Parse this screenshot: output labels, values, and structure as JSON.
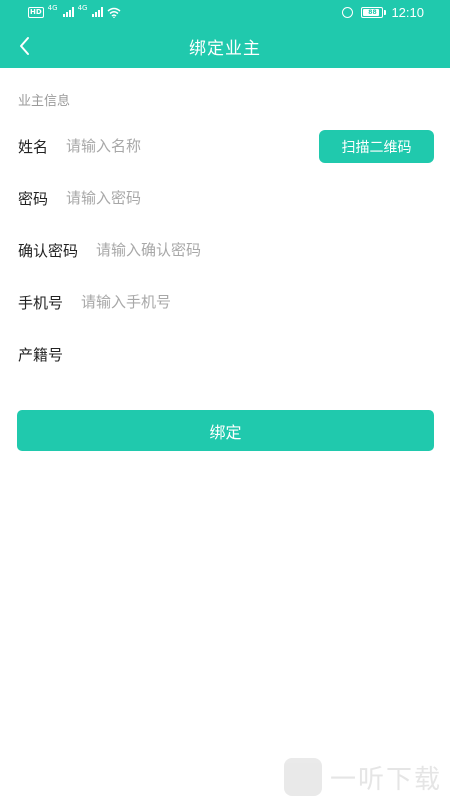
{
  "status_bar": {
    "hd": "HD",
    "sig_tag_1": "4G",
    "sig_tag_2": "4G",
    "battery": "88",
    "time": "12:10"
  },
  "header": {
    "title": "绑定业主"
  },
  "form": {
    "section_title": "业主信息",
    "fields": [
      {
        "label": "姓名",
        "value": "",
        "placeholder": "请输入名称"
      },
      {
        "label": "密码",
        "value": "",
        "placeholder": "请输入密码"
      },
      {
        "label": "确认密码",
        "value": "",
        "placeholder": "请输入确认密码"
      },
      {
        "label": "手机号",
        "value": "",
        "placeholder": "请输入手机号"
      },
      {
        "label": "产籍号",
        "value": "",
        "placeholder": ""
      }
    ],
    "scan_button_label": "扫描二维码",
    "submit_label": "绑定"
  },
  "watermark": {
    "text": "一听下载"
  },
  "colors": {
    "accent": "#20c9ad",
    "label": "#222222",
    "placeholder": "#a8a8a8",
    "section": "#9a9a9a"
  }
}
